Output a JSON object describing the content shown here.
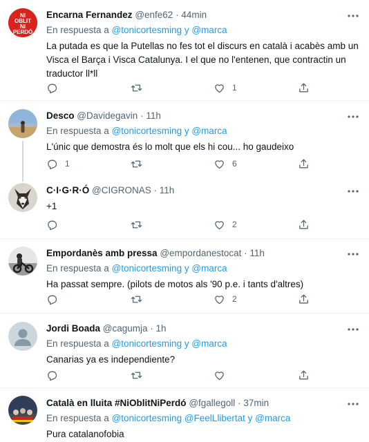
{
  "reply_prefix": "En respuesta a",
  "connector_y": "y",
  "tweets": [
    {
      "name": "Encarna Fernandez",
      "handle": "@enfe62",
      "time": "44min",
      "mentions": [
        "@tonicortesming",
        "@marca"
      ],
      "text": "La putada es que la Putellas no fes tot el discurs en català i acabès amb un Visca el Barça i Visca Catalunya. I el que  no l'entenen, que contractin un traductor ll*ll",
      "counts": {
        "reply": "",
        "retweet": "",
        "like": "1"
      },
      "avatar_label": "NI OBLIT NI PERDÓ"
    },
    {
      "name": "Desco",
      "handle": "@Davidegavin",
      "time": "11h",
      "mentions": [
        "@tonicortesming",
        "@marca"
      ],
      "text": "L'únic que demostra és lo molt que els hi cou... ho gaudeixo",
      "counts": {
        "reply": "1",
        "retweet": "",
        "like": "6"
      }
    },
    {
      "name": "C·I·G·R·Ó",
      "handle": "@CIGRONAS",
      "time": "11h",
      "mentions": [],
      "text": "+1",
      "counts": {
        "reply": "",
        "retweet": "",
        "like": "2"
      }
    },
    {
      "name": "Empordanès amb pressa",
      "handle": "@empordanestocat",
      "time": "11h",
      "mentions": [
        "@tonicortesming",
        "@marca"
      ],
      "text": "Ha passat sempre. (pilots de motos als '90 p.e. i tants d'altres)",
      "counts": {
        "reply": "",
        "retweet": "",
        "like": "2"
      }
    },
    {
      "name": "Jordi Boada",
      "handle": "@cagumja",
      "time": "1h",
      "mentions": [
        "@tonicortesming",
        "@marca"
      ],
      "text": "Canarias ya es independiente?",
      "counts": {
        "reply": "",
        "retweet": "",
        "like": ""
      }
    },
    {
      "name": "Català en lluita #NiOblitNiPerdó",
      "handle": "@fgallegoll",
      "time": "37min",
      "mentions": [
        "@tonicortesming",
        "@FeelLlibertat",
        "@marca"
      ],
      "text": "Pura catalanofobia",
      "counts": {
        "reply": "",
        "retweet": "",
        "like": ""
      }
    }
  ],
  "colors": {
    "accent": "#1d9bf0",
    "text": "#0f1419",
    "secondary": "#536471",
    "divider": "#eff3f4"
  }
}
